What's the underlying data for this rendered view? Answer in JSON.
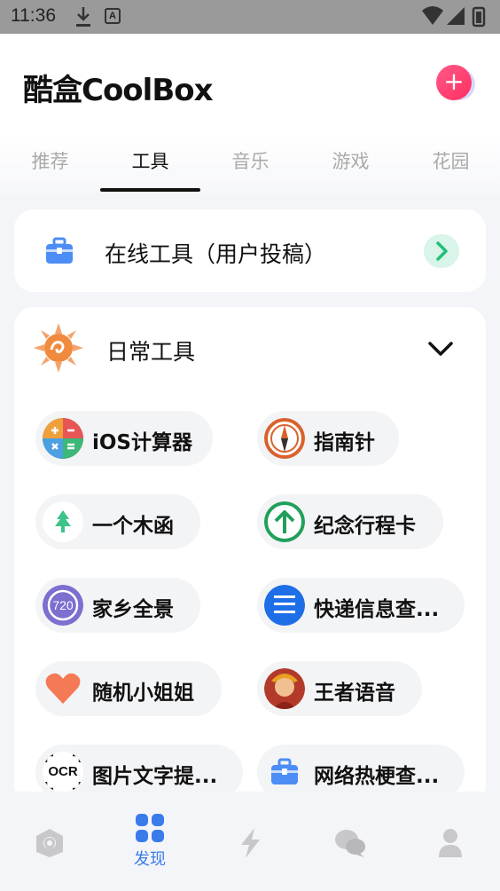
{
  "status_bar": {
    "time": "11:36",
    "notification_icon": "A"
  },
  "header": {
    "app_title": "酷盒CoolBox",
    "add_icon_glyph": "+"
  },
  "tabs": [
    {
      "label": "推荐",
      "active": false
    },
    {
      "label": "工具",
      "active": true
    },
    {
      "label": "音乐",
      "active": false
    },
    {
      "label": "游戏",
      "active": false
    },
    {
      "label": "花园",
      "active": false
    }
  ],
  "online_tools": {
    "label": "在线工具（用户投稿）",
    "icon": "toolbox-icon",
    "action_icon": "chevron-right-icon"
  },
  "daily_tools": {
    "label": "日常工具",
    "icon": "sun-icon",
    "collapse_icon": "chevron-down-icon",
    "items": [
      {
        "label": "iOS计算器"
      },
      {
        "label": "指南针"
      },
      {
        "label": "一个木函"
      },
      {
        "label": "纪念行程卡"
      },
      {
        "label": "家乡全景",
        "icon_text": "720"
      },
      {
        "label": "快递信息查..."
      },
      {
        "label": "随机小姐姐"
      },
      {
        "label": "王者语音"
      },
      {
        "label": "图片文字提...",
        "icon_text": "OCR"
      },
      {
        "label": "网络热梗查..."
      }
    ]
  },
  "bottom_nav": [
    {
      "icon": "home-location-icon",
      "label": "",
      "active": false
    },
    {
      "icon": "discover-grid-icon",
      "label": "发现",
      "active": true
    },
    {
      "icon": "lightning-icon",
      "label": "",
      "active": false
    },
    {
      "icon": "chat-bubbles-icon",
      "label": "",
      "active": false
    },
    {
      "icon": "profile-icon",
      "label": "",
      "active": false
    }
  ],
  "colors": {
    "accent": "#3a7bea",
    "add_button": "#ff3d6b",
    "go_button_bg": "#d9f4e8",
    "go_arrow": "#22c07a"
  }
}
